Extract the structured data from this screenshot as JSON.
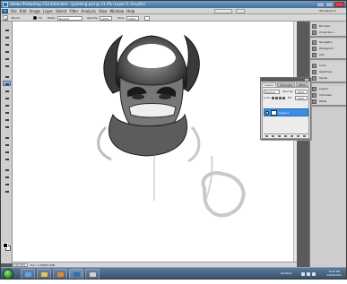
{
  "window": {
    "title": "Adobe Photoshop CS3 Extended - [painting.psd @ 33.3% (Layer 0, Grey/8)]"
  },
  "menu": {
    "app_badge": "Ps",
    "items": [
      "File",
      "Edit",
      "Image",
      "Layer",
      "Select",
      "Filter",
      "Analysis",
      "View",
      "Window",
      "Help"
    ],
    "workspace_label": "Workspace"
  },
  "options": {
    "brush_label": "Brush:",
    "brush_size": "50",
    "mode_label": "Mode:",
    "mode_value": "Normal",
    "opacity_label": "Opacity:",
    "opacity_value": "100%",
    "flow_label": "Flow:",
    "flow_value": "100%"
  },
  "document": {
    "zoom": "33.33%",
    "doc_info": "Doc: 4.39M/4.40M"
  },
  "panels": {
    "group1": [
      "Brushes",
      "Clone Sou..."
    ],
    "group2": [
      "Navigator",
      "Histogram",
      "Info"
    ],
    "group3": [
      "Color",
      "Swatches",
      "Styles"
    ],
    "group4": [
      "Layers",
      "Channels",
      "Paths"
    ]
  },
  "layers_panel": {
    "tabs": [
      "Layers",
      "Channels",
      "Paths"
    ],
    "blend_mode": "Normal",
    "opacity_label": "Opacity:",
    "opacity_value": "100%",
    "lock_label": "Lock:",
    "fill_label": "Fill:",
    "fill_value": "100%",
    "layer_name": "Layer 0"
  },
  "taskbar": {
    "desktop_label": "Desktop",
    "time": "8:27 PM",
    "date": "12/08/2011"
  },
  "colors": {
    "titlebar": "#4f80ad",
    "selection": "#3a8ee6",
    "taskbar": "#2f4866"
  }
}
